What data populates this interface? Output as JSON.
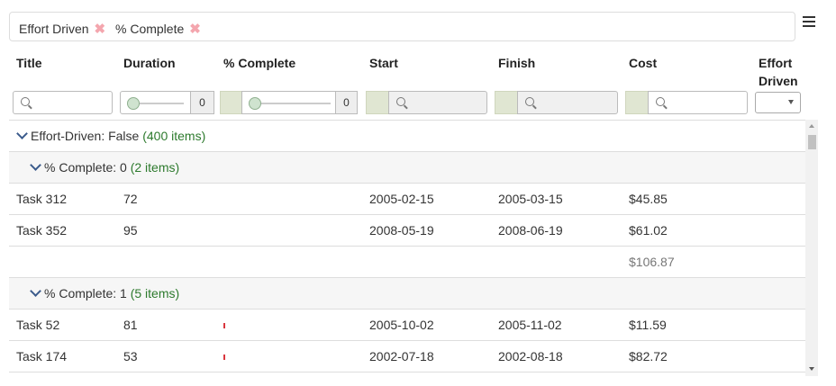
{
  "groupby": {
    "chips": [
      {
        "label": "Effort Driven",
        "remove": "✖"
      },
      {
        "label": "% Complete",
        "remove": "✖"
      }
    ]
  },
  "columns": [
    {
      "key": "title",
      "label": "Title"
    },
    {
      "key": "duration",
      "label": "Duration"
    },
    {
      "key": "pct",
      "label": "% Complete"
    },
    {
      "key": "start",
      "label": "Start"
    },
    {
      "key": "finish",
      "label": "Finish"
    },
    {
      "key": "cost",
      "label": "Cost"
    },
    {
      "key": "effort",
      "label": "Effort Driven"
    }
  ],
  "filters": {
    "duration_value": "0",
    "pct_value": "0"
  },
  "grid": {
    "top_group": {
      "label": "Effort-Driven: False",
      "count": "(400 items)"
    },
    "group1": {
      "label": "% Complete: 0",
      "count": "(2 items)"
    },
    "rows1": [
      {
        "title": "Task 312",
        "duration": "72",
        "start": "2005-02-15",
        "finish": "2005-03-15",
        "cost": "$45.85"
      },
      {
        "title": "Task 352",
        "duration": "95",
        "start": "2008-05-19",
        "finish": "2008-06-19",
        "cost": "$61.02"
      }
    ],
    "group1_total": "$106.87",
    "group2": {
      "label": "% Complete: 1",
      "count": "(5 items)"
    },
    "rows2": [
      {
        "title": "Task 52",
        "duration": "81",
        "pct": 1,
        "start": "2005-10-02",
        "finish": "2005-11-02",
        "cost": "$11.59"
      },
      {
        "title": "Task 174",
        "duration": "53",
        "pct": 1,
        "start": "2002-07-18",
        "finish": "2002-08-18",
        "cost": "$82.72"
      }
    ]
  },
  "colors": {
    "count": "#2d7a2d",
    "progress": "#d9363e",
    "remove": "#f4a6ae"
  }
}
